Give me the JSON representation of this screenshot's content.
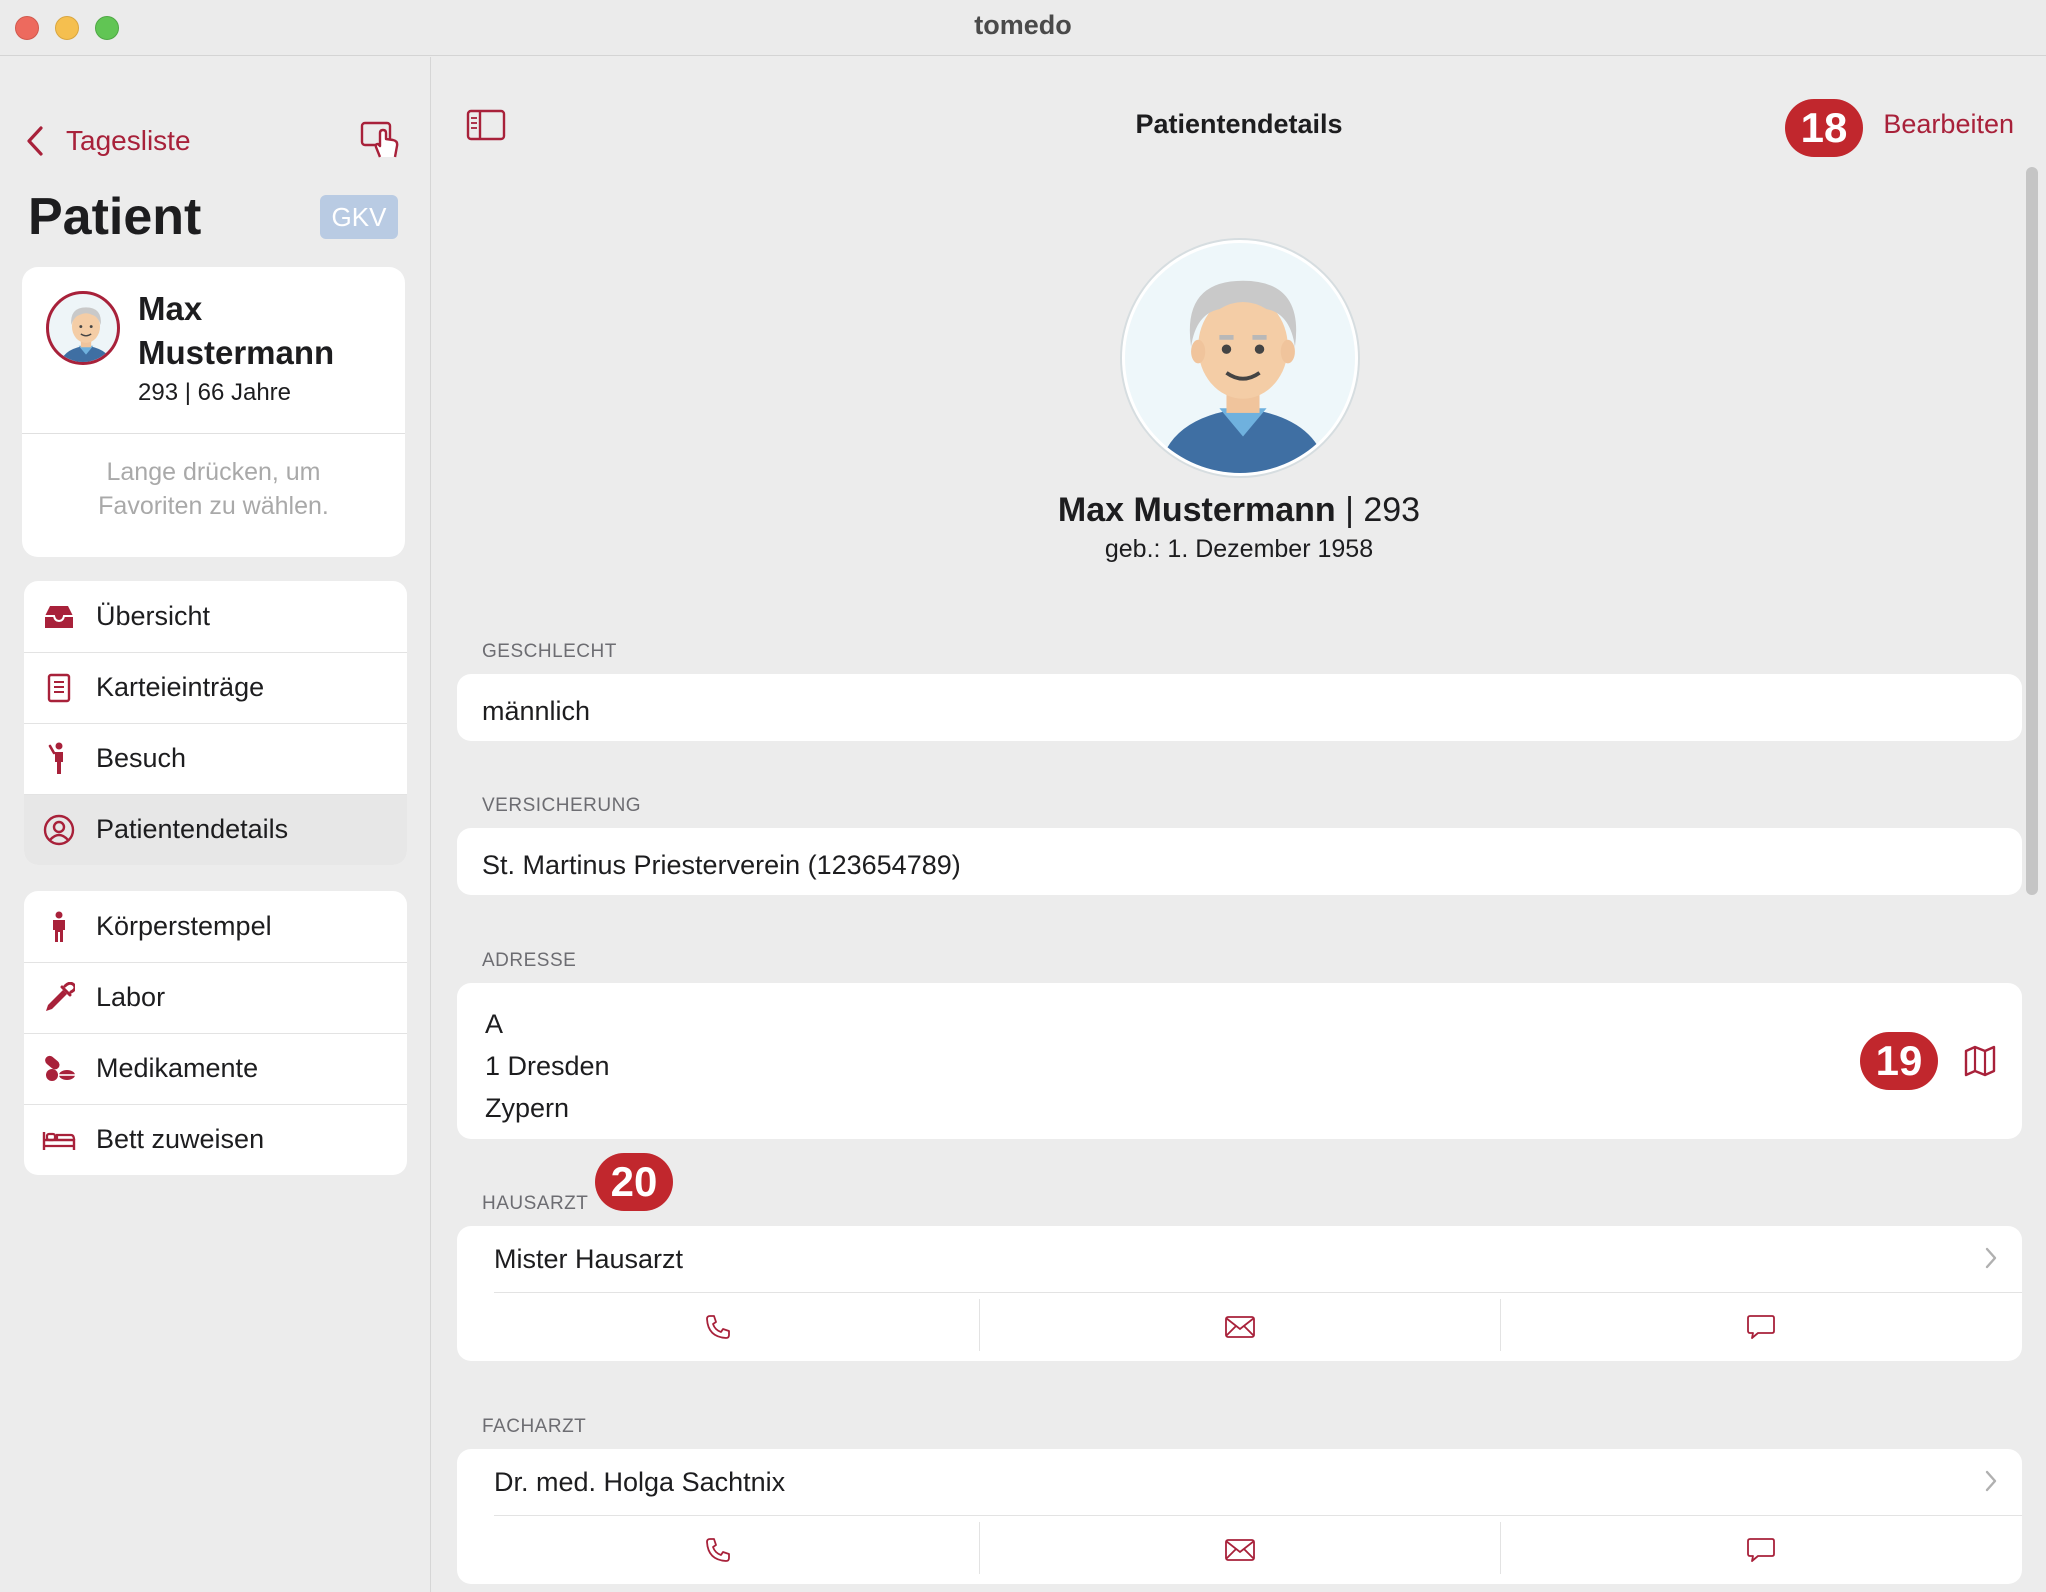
{
  "window": {
    "title": "tomedo"
  },
  "sidebar": {
    "back_label": "Tagesliste",
    "heading": "Patient",
    "insurance_badge": "GKV",
    "patient": {
      "name": "Max Mustermann",
      "meta": "293 | 66 Jahre",
      "favorites_hint": "Lange drücken, um Favoriten zu wählen."
    },
    "menu_group_1": [
      {
        "label": "Übersicht",
        "icon": "inbox-icon"
      },
      {
        "label": "Karteieinträge",
        "icon": "document-list-icon"
      },
      {
        "label": "Besuch",
        "icon": "walking-person-icon"
      },
      {
        "label": "Patientendetails",
        "icon": "person-circle-icon",
        "selected": true
      }
    ],
    "menu_group_2": [
      {
        "label": "Körperstempel",
        "icon": "body-figure-icon"
      },
      {
        "label": "Labor",
        "icon": "pipette-icon"
      },
      {
        "label": "Medikamente",
        "icon": "pills-icon"
      },
      {
        "label": "Bett zuweisen",
        "icon": "bed-icon"
      }
    ]
  },
  "main": {
    "title": "Patientendetails",
    "edit_label": "Bearbeiten",
    "patient_name": "Max  Mustermann",
    "patient_id_sep": " | 293",
    "dob": "geb.:  1. Dezember 1958",
    "gender": {
      "label": "GESCHLECHT",
      "value": "männlich"
    },
    "insurance": {
      "label": "VERSICHERUNG",
      "value": "St. Martinus Priesterverein  (123654789)"
    },
    "address": {
      "label": "ADRESSE",
      "line1": "A",
      "line2": "1  Dresden",
      "line3": "Zypern"
    },
    "gp": {
      "label": "HAUSARZT",
      "name": "Mister Hausarzt"
    },
    "specialist": {
      "label": "FACHARZT",
      "name": "Dr. med. Holga Sachtnix"
    }
  },
  "annotations": {
    "b18": "18",
    "b19": "19",
    "b20": "20"
  },
  "colors": {
    "accent": "#a8213a",
    "badge": "#c1272d",
    "background": "#ececec"
  }
}
